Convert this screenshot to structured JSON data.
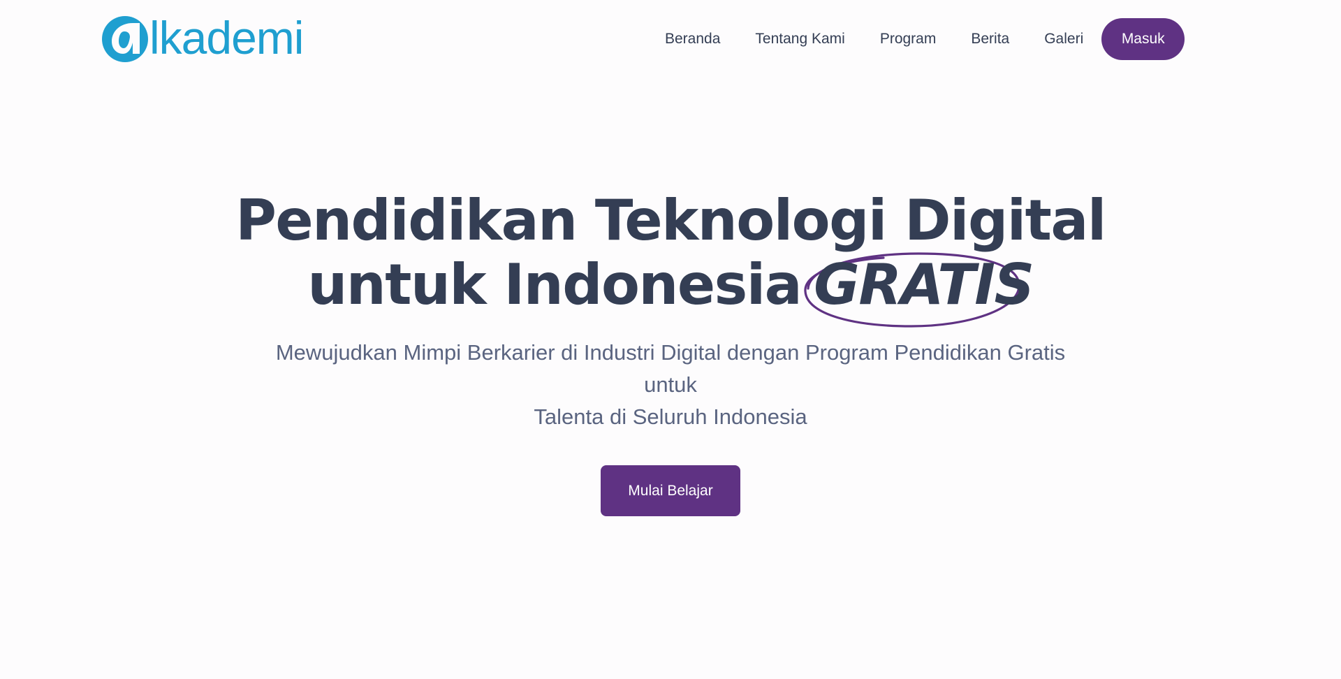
{
  "brand": {
    "name": "lkademi",
    "logo_icon": "alpha-circle-icon",
    "color": "#1f9fd0"
  },
  "nav": {
    "items": [
      {
        "label": "Beranda"
      },
      {
        "label": "Tentang Kami"
      },
      {
        "label": "Program"
      },
      {
        "label": "Berita"
      },
      {
        "label": "Galeri"
      }
    ],
    "login_label": "Masuk"
  },
  "hero": {
    "title_line1": "Pendidikan Teknologi Digital",
    "title_line2": "untuk Indonesia",
    "highlight": "GRATIS",
    "subtitle_line1": "Mewujudkan Mimpi Berkarier di Industri Digital dengan Program Pendidikan Gratis untuk",
    "subtitle_line2": "Talenta di Seluruh Indonesia",
    "cta_label": "Mulai Belajar"
  },
  "colors": {
    "accent": "#5f3283",
    "text": "#343e54",
    "muted": "#5a6480",
    "background": "#fdfcfd"
  }
}
